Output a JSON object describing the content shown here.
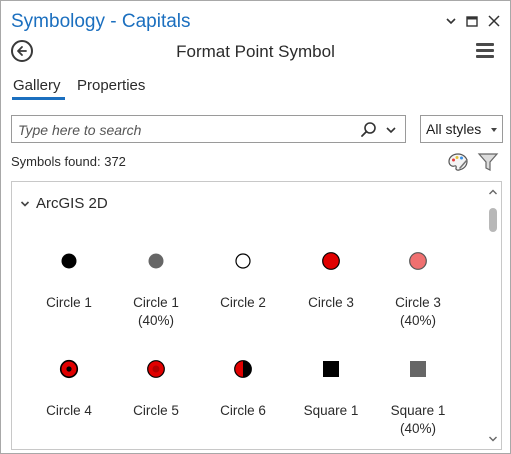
{
  "window": {
    "title": "Symbology - Capitals",
    "controls": [
      "chevron-down-icon",
      "maximize-icon",
      "close-icon"
    ]
  },
  "header": {
    "title": "Format Point Symbol",
    "back_icon": "back-arrow-icon",
    "menu_icon": "hamburger-menu-icon"
  },
  "tabs": [
    {
      "label": "Gallery",
      "active": true
    },
    {
      "label": "Properties",
      "active": false
    }
  ],
  "search": {
    "placeholder": "Type here to search",
    "value": "",
    "icon": "search-icon"
  },
  "style_filter": {
    "selected": "All styles"
  },
  "symbols_found": "Symbols found: 372",
  "gallery": {
    "group": "ArcGIS 2D",
    "items": [
      {
        "label": "Circle 1",
        "sublabel": "",
        "icon": "circle-black"
      },
      {
        "label": "Circle 1",
        "sublabel": "(40%)",
        "icon": "circle-gray"
      },
      {
        "label": "Circle 2",
        "sublabel": "",
        "icon": "circle-hollow"
      },
      {
        "label": "Circle 3",
        "sublabel": "",
        "icon": "circle-red"
      },
      {
        "label": "Circle 3",
        "sublabel": "(40%)",
        "icon": "circle-light-red"
      },
      {
        "label": "Circle 4",
        "sublabel": "",
        "icon": "circle-bullseye"
      },
      {
        "label": "Circle 5",
        "sublabel": "",
        "icon": "circle-red-dot"
      },
      {
        "label": "Circle 6",
        "sublabel": "",
        "icon": "circle-half"
      },
      {
        "label": "Square 1",
        "sublabel": "",
        "icon": "square-black"
      },
      {
        "label": "Square 1",
        "sublabel": "(40%)",
        "icon": "square-gray"
      }
    ]
  },
  "colors": {
    "accent": "#1b6fbf",
    "red": "#e00000",
    "light_red": "#f27a7a",
    "gray": "#6e6e6e"
  }
}
